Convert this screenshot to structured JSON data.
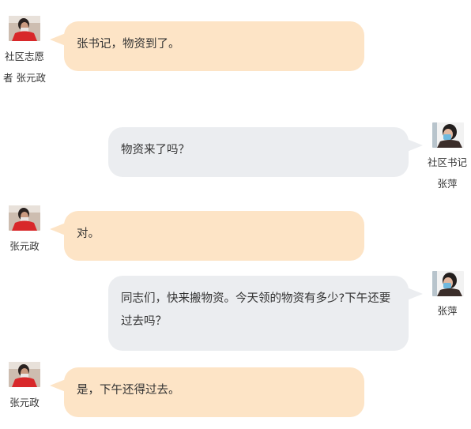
{
  "chat": {
    "messages": [
      {
        "side": "left",
        "avatar": "volunteer-avatar",
        "sender": "社区志愿者 张元政",
        "text": "张书记，物资到了。"
      },
      {
        "side": "right",
        "avatar": "secretary-avatar",
        "sender": "社区书记 张萍",
        "text": "物资来了吗？"
      },
      {
        "side": "left",
        "avatar": "volunteer-avatar",
        "sender": "张元政",
        "text": "对。"
      },
      {
        "side": "right",
        "avatar": "secretary-avatar",
        "sender": "张萍",
        "text": "同志们，快来搬物资。今天领的物资有多少?下午还要过去吗？"
      },
      {
        "side": "left",
        "avatar": "volunteer-avatar",
        "sender": "张元政",
        "text": "是，下午还得过去。"
      }
    ]
  },
  "colors": {
    "left_bubble": "#fde4c6",
    "right_bubble": "#ebedf0",
    "text": "#333333"
  }
}
